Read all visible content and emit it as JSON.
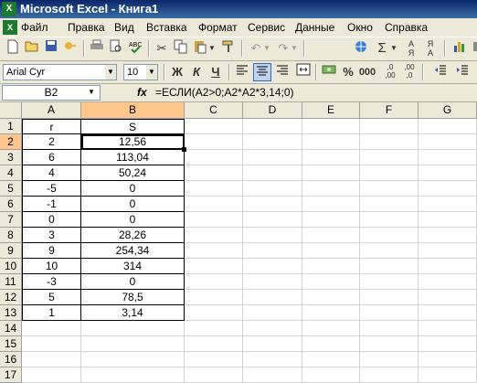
{
  "window": {
    "title": "Microsoft Excel - Книга1",
    "app_icon": "excel-icon"
  },
  "menu": [
    "Файл",
    "Правка",
    "Вид",
    "Вставка",
    "Формат",
    "Сервис",
    "Данные",
    "Окно",
    "Справка"
  ],
  "format_toolbar": {
    "font": "Arial Cyr",
    "size": "10",
    "bold": "Ж",
    "italic": "К",
    "underline": "Ч"
  },
  "formula_bar": {
    "name_box": "B2",
    "fx": "fx",
    "formula": "=ЕСЛИ(A2>0;A2*A2*3,14;0)"
  },
  "columns": [
    "A",
    "B",
    "C",
    "D",
    "E",
    "F",
    "G"
  ],
  "rows": [
    "1",
    "2",
    "3",
    "4",
    "5",
    "6",
    "7",
    "8",
    "9",
    "10",
    "11",
    "12",
    "13",
    "14",
    "15",
    "16",
    "17"
  ],
  "cells": {
    "A": [
      "r",
      "2",
      "6",
      "4",
      "-5",
      "-1",
      "0",
      "3",
      "9",
      "10",
      "-3",
      "5",
      "1"
    ],
    "B": [
      "S",
      "12,56",
      "113,04",
      "50,24",
      "0",
      "0",
      "0",
      "28,26",
      "254,34",
      "314",
      "0",
      "78,5",
      "3,14"
    ]
  },
  "active_cell": "B2"
}
